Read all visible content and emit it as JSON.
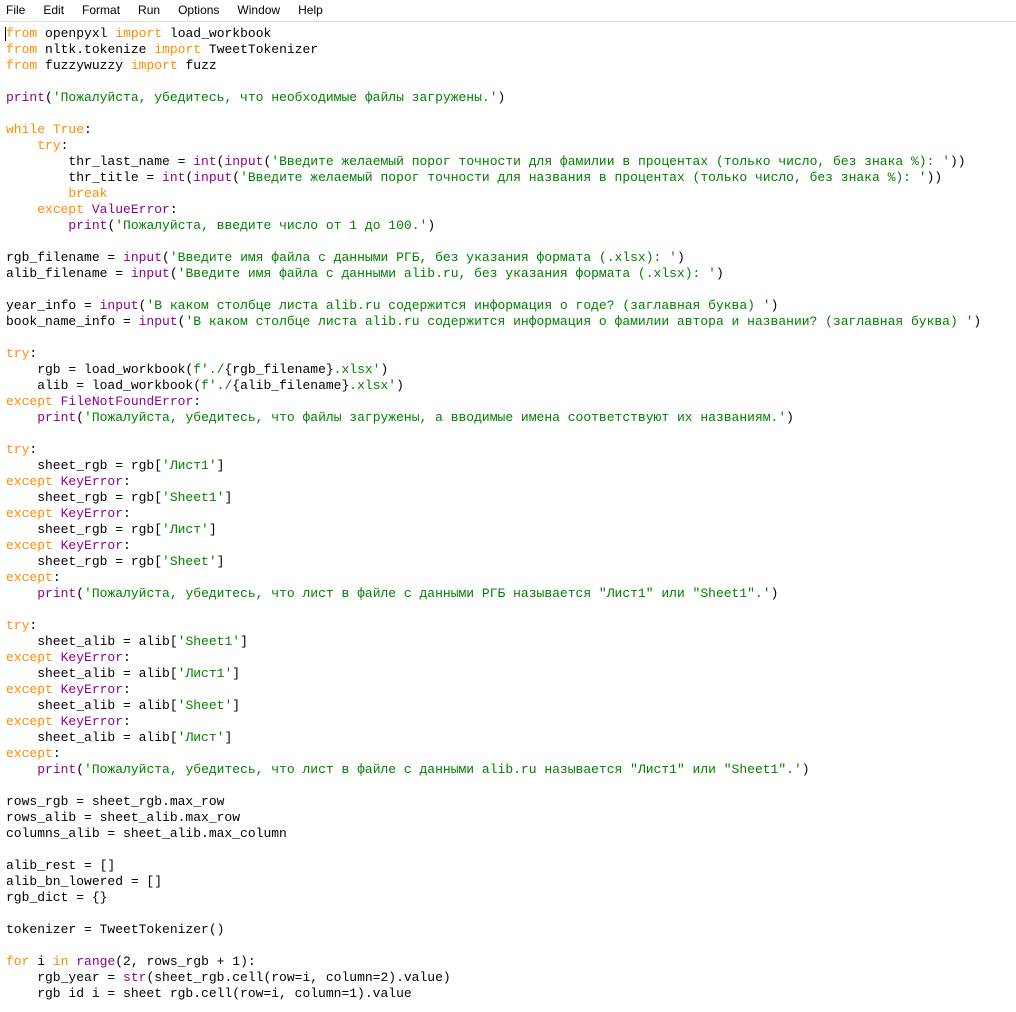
{
  "menu": {
    "file": "File",
    "edit": "Edit",
    "format": "Format",
    "run": "Run",
    "options": "Options",
    "window": "Window",
    "help": "Help"
  },
  "kw": {
    "from": "from",
    "import": "import",
    "while": "while",
    "true": "True",
    "try": "try",
    "break": "break",
    "except": "except",
    "for": "for",
    "in": "in"
  },
  "bi": {
    "print": "print",
    "int": "int",
    "input": "input",
    "ValueError": "ValueError",
    "FileNotFoundError": "FileNotFoundError",
    "KeyError": "KeyError",
    "range": "range",
    "str": "str"
  },
  "mod": {
    "openpyxl": "openpyxl",
    "load_workbook": "load_workbook",
    "nltk_tokenize": "nltk.tokenize",
    "tweettokenizer": "TweetTokenizer",
    "fuzzywuzzy": "fuzzywuzzy",
    "fuzz": "fuzz"
  },
  "s": {
    "intro": "'Пожалуйста, убедитесь, что необходимые файлы загружены.'",
    "thr_last": "'Введите желаемый порог точности для фамилии в процентах (только число, без знака %): '",
    "thr_title": "'Введите желаемый порог точности для названия в процентах (только число, без знака %): '",
    "val_err": "'Пожалуйста, введите число от 1 до 100.'",
    "rgb_file": "'Введите имя файла с данными РГБ, без указания формата (.xlsx): '",
    "alib_file": "'Введите имя файла с данными alib.ru, без указания формата (.xlsx): '",
    "year_info": "'В каком столбце листа alib.ru содержится информация о годе? (заглавная буква) '",
    "book_name_info": "'В каком столбце листа alib.ru содержится информация о фамилии автора и названии? (заглавная буква) '",
    "f_rgb_a": "f'./",
    "f_rgb_b": ".xlsx'",
    "f_alib_a": "f'./",
    "f_alib_b": ".xlsx'",
    "fnf": "'Пожалуйста, убедитесь, что файлы загружены, а вводимые имена соответствуют их названиям.'",
    "list1_ru": "'Лист1'",
    "sheet1": "'Sheet1'",
    "list_ru": "'Лист'",
    "sheet": "'Sheet'",
    "rgb_sheet_err": "'Пожалуйста, убедитесь, что лист в файле с данными РГБ называется \"Лист1\" или \"Sheet1\".'",
    "alib_sheet_err": "'Пожалуйста, убедитесь, что лист в файле с данными alib.ru называется \"Лист1\" или \"Sheet1\".'"
  },
  "t": {
    "colon": ":",
    "thr_last_name_eq": "        thr_last_name = ",
    "thr_title_eq": "        thr_title = ",
    "rgb_filename_eq": "rgb_filename = ",
    "alib_filename_eq": "alib_filename = ",
    "year_info_eq": "year_info = ",
    "book_name_info_eq": "book_name_info = ",
    "rgb_eq": "    rgb = load_workbook(",
    "alib_eq": "    alib = load_workbook(",
    "brace_rgb": "{rgb_filename}",
    "brace_alib": "{alib_filename}",
    "sheet_rgb_eq": "    sheet_rgb = rgb[",
    "sheet_alib_eq": "    sheet_alib = alib[",
    "rows_rgb": "rows_rgb = sheet_rgb.max_row",
    "rows_alib": "rows_alib = sheet_alib.max_row",
    "cols_alib": "columns_alib = sheet_alib.max_column",
    "alib_rest": "alib_rest = []",
    "alib_bn": "alib_bn_lowered = []",
    "rgb_dict": "rgb_dict = {}",
    "tokenizer": "tokenizer = TweetTokenizer()",
    "range_args": "(2, rows_rgb + 1):",
    "rgb_year_eq": "    rgb_year = ",
    "rgb_year_rest": "(sheet_rgb.cell(row=i, column=2).value)",
    "rgb_id": "    rgb id i = sheet rgb.cell(row=i, column=1).value",
    "print_indent": "    ",
    "print8": "        ",
    "i_space": " i ",
    "paren_open": "(",
    "paren_close": ")",
    "paren_close2": "))",
    "sq_close": "]",
    "space": " "
  }
}
